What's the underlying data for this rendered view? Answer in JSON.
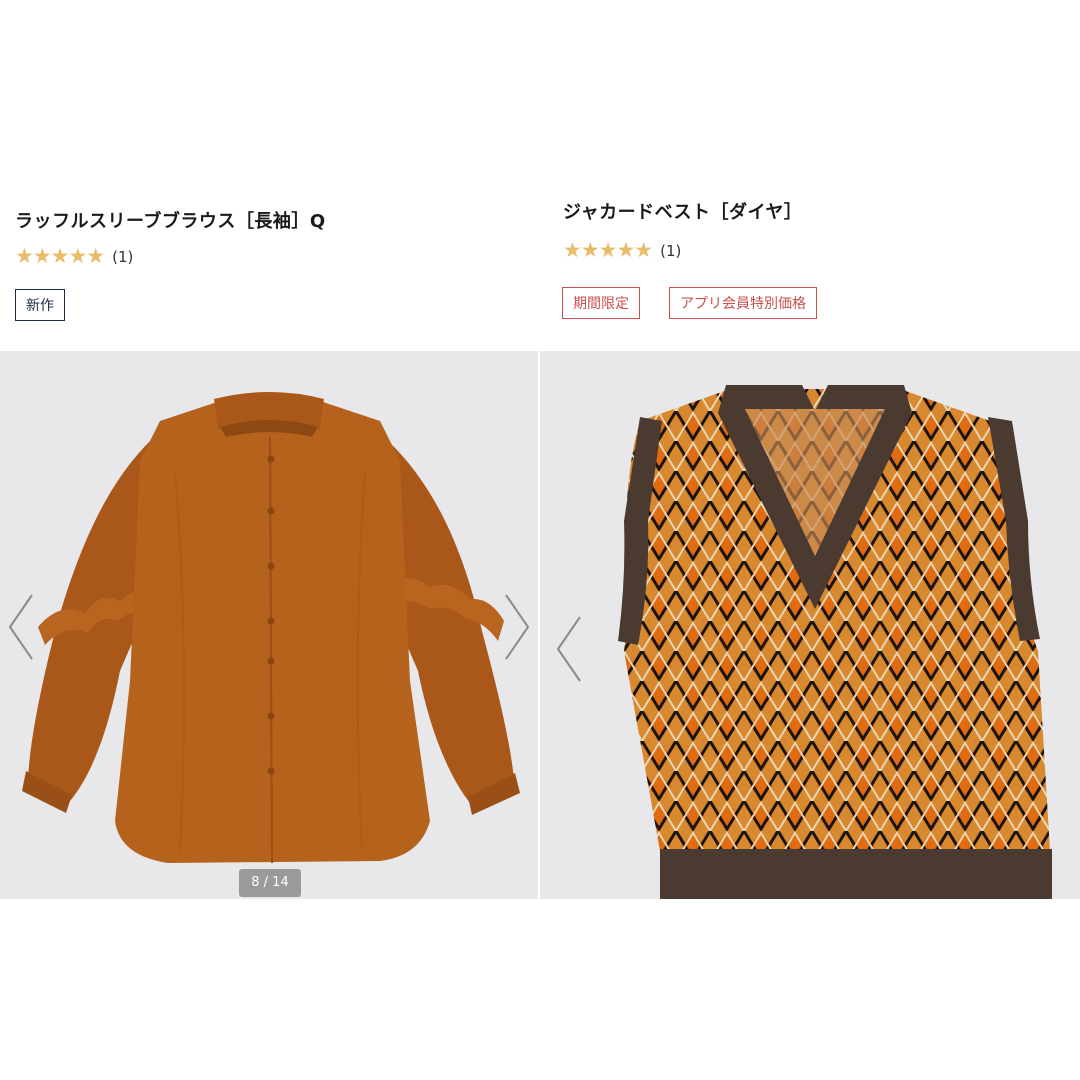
{
  "products": [
    {
      "name": "ラッフルスリーブブラウス［長袖］Q",
      "rating_stars": "★★★★★",
      "rating_value": 5,
      "review_count": "(1)",
      "badges": [
        "新作"
      ],
      "image_counter": "8 / 14",
      "garment_color": "#b5621d"
    },
    {
      "name": "ジャカードベスト［ダイヤ］",
      "rating_stars": "★★★★★",
      "rating_value": 5,
      "review_count": "(1)",
      "badges": [
        "期間限定",
        "アプリ会員特別価格"
      ],
      "garment_colors": {
        "body": "#d88930",
        "trim": "#4a3a30",
        "accent": "#e06b10",
        "line": "#1a1410",
        "cream": "#e9d7b4"
      }
    }
  ],
  "icons": {
    "prev": "chevron-left-icon",
    "next": "chevron-right-icon",
    "star": "star-icon"
  }
}
